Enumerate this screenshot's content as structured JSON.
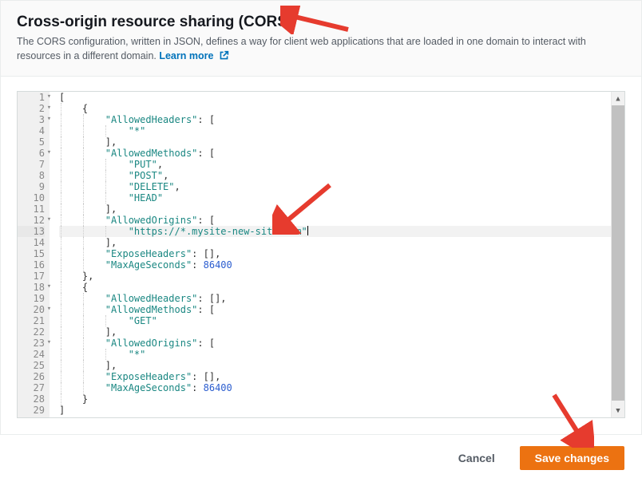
{
  "header": {
    "title": "Cross-origin resource sharing (CORS)",
    "description": "The CORS configuration, written in JSON, defines a way for client web applications that are loaded in one domain to interact with resources in a different domain. ",
    "learn_more": "Learn more"
  },
  "editor": {
    "current_line": 13,
    "fold_lines": [
      1,
      2,
      3,
      6,
      12,
      18,
      20,
      23
    ],
    "lines": [
      {
        "n": 1,
        "indent": 0,
        "raw": "["
      },
      {
        "n": 2,
        "indent": 1,
        "raw": "{"
      },
      {
        "n": 3,
        "indent": 2,
        "key": "AllowedHeaders",
        "after": ": ["
      },
      {
        "n": 4,
        "indent": 3,
        "str": "*"
      },
      {
        "n": 5,
        "indent": 2,
        "raw": "],"
      },
      {
        "n": 6,
        "indent": 2,
        "key": "AllowedMethods",
        "after": ": ["
      },
      {
        "n": 7,
        "indent": 3,
        "str": "PUT",
        "comma": true
      },
      {
        "n": 8,
        "indent": 3,
        "str": "POST",
        "comma": true
      },
      {
        "n": 9,
        "indent": 3,
        "str": "DELETE",
        "comma": true
      },
      {
        "n": 10,
        "indent": 3,
        "str": "HEAD"
      },
      {
        "n": 11,
        "indent": 2,
        "raw": "],"
      },
      {
        "n": 12,
        "indent": 2,
        "key": "AllowedOrigins",
        "after": ": ["
      },
      {
        "n": 13,
        "indent": 3,
        "str": "https://*.mysite-new-site.com",
        "cursor": true
      },
      {
        "n": 14,
        "indent": 2,
        "raw": "],"
      },
      {
        "n": 15,
        "indent": 2,
        "key": "ExposeHeaders",
        "after": ": [],"
      },
      {
        "n": 16,
        "indent": 2,
        "key": "MaxAgeSeconds",
        "after": ": ",
        "num": 86400
      },
      {
        "n": 17,
        "indent": 1,
        "raw": "},"
      },
      {
        "n": 18,
        "indent": 1,
        "raw": "{"
      },
      {
        "n": 19,
        "indent": 2,
        "key": "AllowedHeaders",
        "after": ": [],"
      },
      {
        "n": 20,
        "indent": 2,
        "key": "AllowedMethods",
        "after": ": ["
      },
      {
        "n": 21,
        "indent": 3,
        "str": "GET"
      },
      {
        "n": 22,
        "indent": 2,
        "raw": "],"
      },
      {
        "n": 23,
        "indent": 2,
        "key": "AllowedOrigins",
        "after": ": ["
      },
      {
        "n": 24,
        "indent": 3,
        "str": "*"
      },
      {
        "n": 25,
        "indent": 2,
        "raw": "],"
      },
      {
        "n": 26,
        "indent": 2,
        "key": "ExposeHeaders",
        "after": ": [],"
      },
      {
        "n": 27,
        "indent": 2,
        "key": "MaxAgeSeconds",
        "after": ": ",
        "num": 86400
      },
      {
        "n": 28,
        "indent": 1,
        "raw": "}"
      },
      {
        "n": 29,
        "indent": 0,
        "raw": "]"
      }
    ]
  },
  "footer": {
    "cancel": "Cancel",
    "save": "Save changes"
  }
}
